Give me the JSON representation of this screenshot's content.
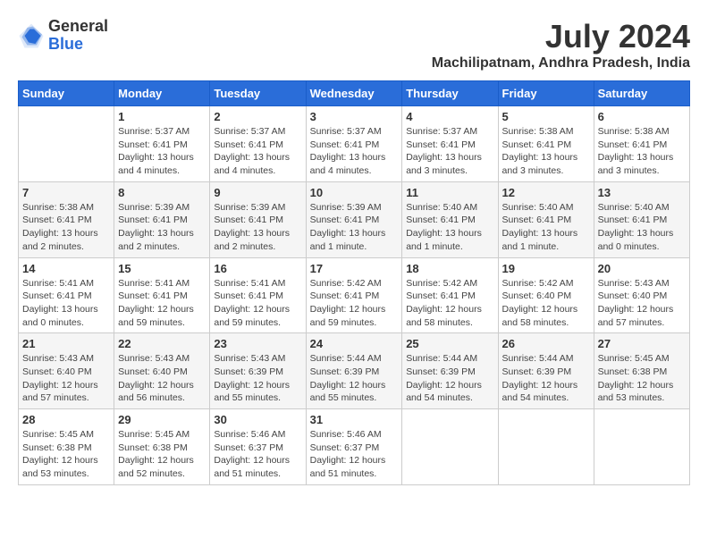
{
  "logo": {
    "general": "General",
    "blue": "Blue"
  },
  "title": {
    "month_year": "July 2024",
    "location": "Machilipatnam, Andhra Pradesh, India"
  },
  "days_of_week": [
    "Sunday",
    "Monday",
    "Tuesday",
    "Wednesday",
    "Thursday",
    "Friday",
    "Saturday"
  ],
  "weeks": [
    [
      {
        "day": "",
        "info": ""
      },
      {
        "day": "1",
        "info": "Sunrise: 5:37 AM\nSunset: 6:41 PM\nDaylight: 13 hours and 4 minutes."
      },
      {
        "day": "2",
        "info": "Sunrise: 5:37 AM\nSunset: 6:41 PM\nDaylight: 13 hours and 4 minutes."
      },
      {
        "day": "3",
        "info": "Sunrise: 5:37 AM\nSunset: 6:41 PM\nDaylight: 13 hours and 4 minutes."
      },
      {
        "day": "4",
        "info": "Sunrise: 5:37 AM\nSunset: 6:41 PM\nDaylight: 13 hours and 3 minutes."
      },
      {
        "day": "5",
        "info": "Sunrise: 5:38 AM\nSunset: 6:41 PM\nDaylight: 13 hours and 3 minutes."
      },
      {
        "day": "6",
        "info": "Sunrise: 5:38 AM\nSunset: 6:41 PM\nDaylight: 13 hours and 3 minutes."
      }
    ],
    [
      {
        "day": "7",
        "info": "Sunrise: 5:38 AM\nSunset: 6:41 PM\nDaylight: 13 hours and 2 minutes."
      },
      {
        "day": "8",
        "info": "Sunrise: 5:39 AM\nSunset: 6:41 PM\nDaylight: 13 hours and 2 minutes."
      },
      {
        "day": "9",
        "info": "Sunrise: 5:39 AM\nSunset: 6:41 PM\nDaylight: 13 hours and 2 minutes."
      },
      {
        "day": "10",
        "info": "Sunrise: 5:39 AM\nSunset: 6:41 PM\nDaylight: 13 hours and 1 minute."
      },
      {
        "day": "11",
        "info": "Sunrise: 5:40 AM\nSunset: 6:41 PM\nDaylight: 13 hours and 1 minute."
      },
      {
        "day": "12",
        "info": "Sunrise: 5:40 AM\nSunset: 6:41 PM\nDaylight: 13 hours and 1 minute."
      },
      {
        "day": "13",
        "info": "Sunrise: 5:40 AM\nSunset: 6:41 PM\nDaylight: 13 hours and 0 minutes."
      }
    ],
    [
      {
        "day": "14",
        "info": "Sunrise: 5:41 AM\nSunset: 6:41 PM\nDaylight: 13 hours and 0 minutes."
      },
      {
        "day": "15",
        "info": "Sunrise: 5:41 AM\nSunset: 6:41 PM\nDaylight: 12 hours and 59 minutes."
      },
      {
        "day": "16",
        "info": "Sunrise: 5:41 AM\nSunset: 6:41 PM\nDaylight: 12 hours and 59 minutes."
      },
      {
        "day": "17",
        "info": "Sunrise: 5:42 AM\nSunset: 6:41 PM\nDaylight: 12 hours and 59 minutes."
      },
      {
        "day": "18",
        "info": "Sunrise: 5:42 AM\nSunset: 6:41 PM\nDaylight: 12 hours and 58 minutes."
      },
      {
        "day": "19",
        "info": "Sunrise: 5:42 AM\nSunset: 6:40 PM\nDaylight: 12 hours and 58 minutes."
      },
      {
        "day": "20",
        "info": "Sunrise: 5:43 AM\nSunset: 6:40 PM\nDaylight: 12 hours and 57 minutes."
      }
    ],
    [
      {
        "day": "21",
        "info": "Sunrise: 5:43 AM\nSunset: 6:40 PM\nDaylight: 12 hours and 57 minutes."
      },
      {
        "day": "22",
        "info": "Sunrise: 5:43 AM\nSunset: 6:40 PM\nDaylight: 12 hours and 56 minutes."
      },
      {
        "day": "23",
        "info": "Sunrise: 5:43 AM\nSunset: 6:39 PM\nDaylight: 12 hours and 55 minutes."
      },
      {
        "day": "24",
        "info": "Sunrise: 5:44 AM\nSunset: 6:39 PM\nDaylight: 12 hours and 55 minutes."
      },
      {
        "day": "25",
        "info": "Sunrise: 5:44 AM\nSunset: 6:39 PM\nDaylight: 12 hours and 54 minutes."
      },
      {
        "day": "26",
        "info": "Sunrise: 5:44 AM\nSunset: 6:39 PM\nDaylight: 12 hours and 54 minutes."
      },
      {
        "day": "27",
        "info": "Sunrise: 5:45 AM\nSunset: 6:38 PM\nDaylight: 12 hours and 53 minutes."
      }
    ],
    [
      {
        "day": "28",
        "info": "Sunrise: 5:45 AM\nSunset: 6:38 PM\nDaylight: 12 hours and 53 minutes."
      },
      {
        "day": "29",
        "info": "Sunrise: 5:45 AM\nSunset: 6:38 PM\nDaylight: 12 hours and 52 minutes."
      },
      {
        "day": "30",
        "info": "Sunrise: 5:46 AM\nSunset: 6:37 PM\nDaylight: 12 hours and 51 minutes."
      },
      {
        "day": "31",
        "info": "Sunrise: 5:46 AM\nSunset: 6:37 PM\nDaylight: 12 hours and 51 minutes."
      },
      {
        "day": "",
        "info": ""
      },
      {
        "day": "",
        "info": ""
      },
      {
        "day": "",
        "info": ""
      }
    ]
  ]
}
